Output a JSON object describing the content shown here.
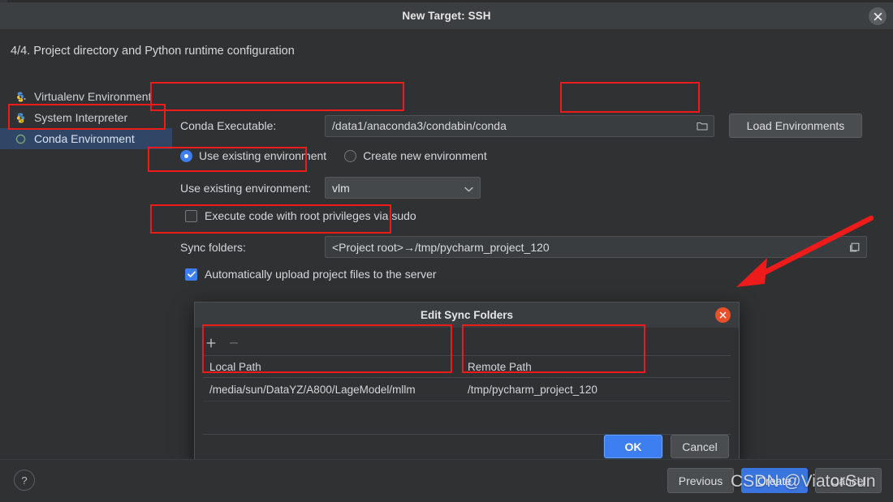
{
  "window": {
    "title": "New Target: SSH",
    "close_icon": "close-icon",
    "step_title": "4/4. Project directory and Python runtime configuration"
  },
  "sidebar": {
    "items": [
      {
        "label": "Virtualenv Environment",
        "icon": "virtualenv-icon",
        "selected": false
      },
      {
        "label": "System Interpreter",
        "icon": "python-icon",
        "selected": false
      },
      {
        "label": "Conda Environment",
        "icon": "conda-icon",
        "selected": true
      }
    ]
  },
  "form": {
    "conda_executable": {
      "label": "Conda Executable:",
      "value": "/data1/anaconda3/condabin/conda",
      "browse_icon": "folder-icon"
    },
    "load_environments_button": "Load Environments",
    "env_mode": {
      "use_existing": "Use existing environment",
      "create_new": "Create new environment",
      "selected": "use_existing"
    },
    "existing_env": {
      "label": "Use existing environment:",
      "value": "vlm",
      "chevron_icon": "chevron-down-icon"
    },
    "sudo_checkbox": {
      "label": "Execute code with root privileges via sudo",
      "checked": false
    },
    "sync_folders": {
      "label": "Sync folders:",
      "value": "<Project root>→/tmp/pycharm_project_120",
      "browse_icon": "folder-icon"
    },
    "auto_upload_checkbox": {
      "label": "Automatically upload project files to the server",
      "checked": true
    }
  },
  "dialog": {
    "title": "Edit Sync Folders",
    "close_icon": "close-icon",
    "toolbar": {
      "add_icon": "plus-icon",
      "remove_icon": "minus-icon"
    },
    "table": {
      "columns": [
        "Local Path",
        "Remote Path",
        ""
      ],
      "rows": [
        [
          "/media/sun/DataYZ/A800/LageModel/mllm",
          "/tmp/pycharm_project_120",
          ""
        ]
      ]
    },
    "ok_button": "OK",
    "cancel_button": "Cancel"
  },
  "footer": {
    "help_icon": "question-icon",
    "previous_button": "Previous",
    "create_button": "Create",
    "cancel_button": "Cancel"
  },
  "watermark": "CSDN @ViatorSun",
  "annotation": {
    "accent_color": "#ee1b1b",
    "arrow_icon": "arrow-pointing-left-down"
  }
}
